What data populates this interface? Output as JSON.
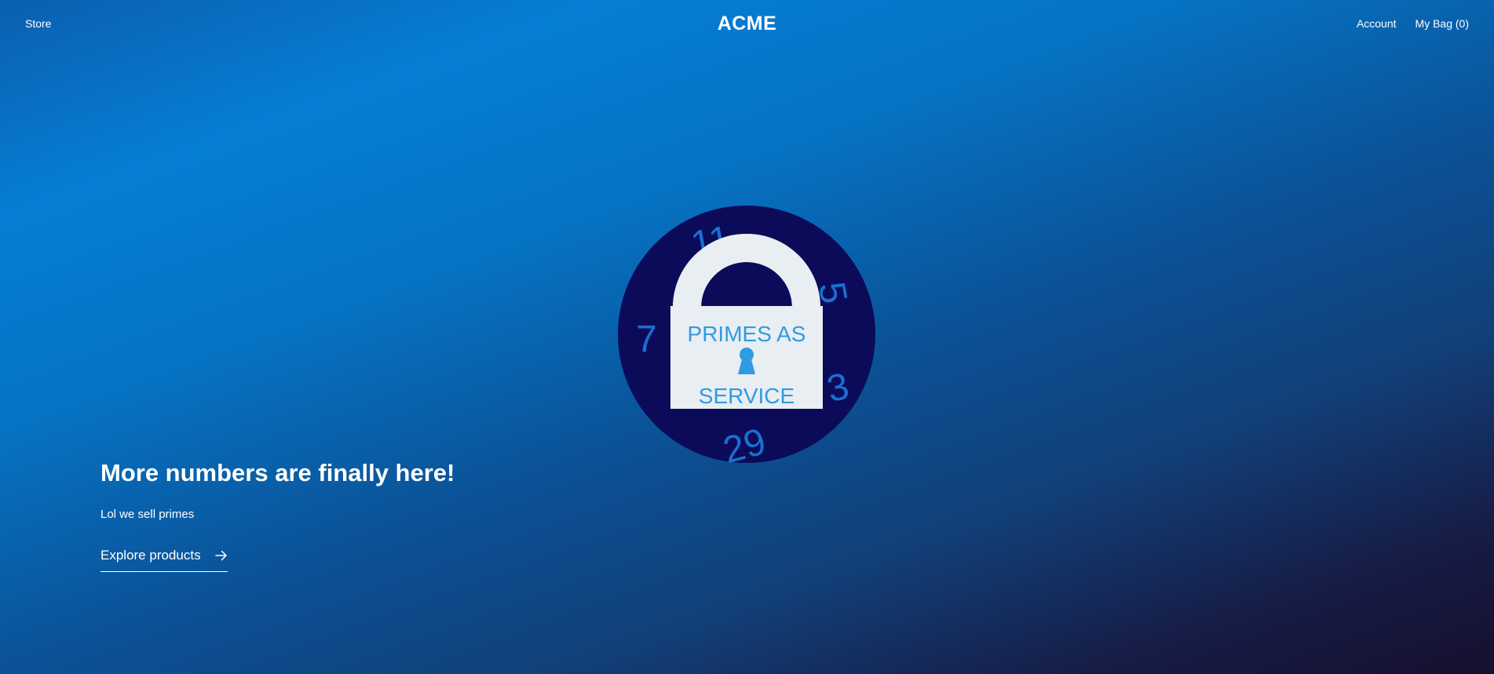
{
  "header": {
    "store_label": "Store",
    "brand": "ACME",
    "account_label": "Account",
    "bag_label": "My Bag (0)"
  },
  "hero": {
    "logo": {
      "text_line1": "PRIMES AS",
      "text_line2": "SERVICE",
      "numbers": [
        "11",
        "5",
        "7",
        "3",
        "29"
      ],
      "colors": {
        "circle": "#0b0b5a",
        "lock": "#e8eef2",
        "accent": "#2f9be2",
        "number": "#1a6fcf"
      }
    },
    "title": "More numbers are finally here!",
    "subtitle": "Lol we sell primes",
    "cta_label": "Explore products",
    "cta_icon": "arrow-right-icon"
  }
}
